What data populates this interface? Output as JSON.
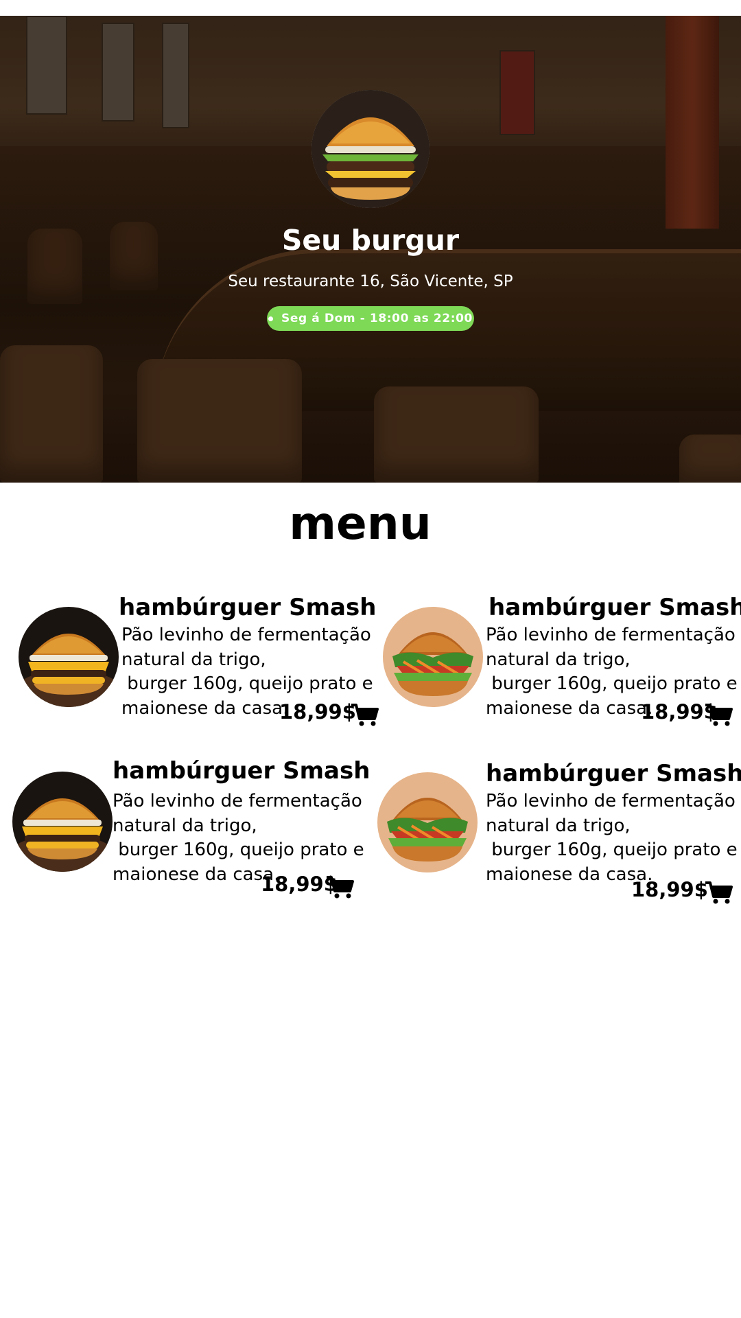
{
  "hero": {
    "restaurant_name": "Seu burgur",
    "address": "Seu restaurante 16, São Vicente, SP",
    "hours": "Seg á Dom - 18:00 as 22:00",
    "badge_color": "#7ed957",
    "logo_icon": "burger-logo-icon"
  },
  "menu": {
    "title": "menu",
    "items": [
      {
        "name": "hambúrguer Smash",
        "description": "Pão levinho de fermentação\nnatural da trigo,\n burger 160g, queijo prato e\nmaionese da casa.",
        "price": "18,99$",
        "photo": "cheeseburger-photo",
        "cart_icon": "cart-icon"
      },
      {
        "name": "hambúrguer Smash",
        "description": "Pão levinho de fermentação\nnatural da trigo,\n burger 160g, queijo prato e\nmaionese da casa.",
        "price": "18,99$",
        "photo": "veggie-burger-photo",
        "cart_icon": "cart-icon"
      },
      {
        "name": "hambúrguer Smash",
        "description": "Pão levinho de fermentação\nnatural da trigo,\n burger 160g, queijo prato e\nmaionese da casa.",
        "price": "18,99$",
        "photo": "cheeseburger-photo",
        "cart_icon": "cart-icon"
      },
      {
        "name": "hambúrguer Smash",
        "description": "Pão levinho de fermentação\nnatural da trigo,\n burger 160g, queijo prato e\nmaionese da casa.",
        "price": "18,99$",
        "photo": "veggie-burger-photo",
        "cart_icon": "cart-icon"
      }
    ]
  }
}
